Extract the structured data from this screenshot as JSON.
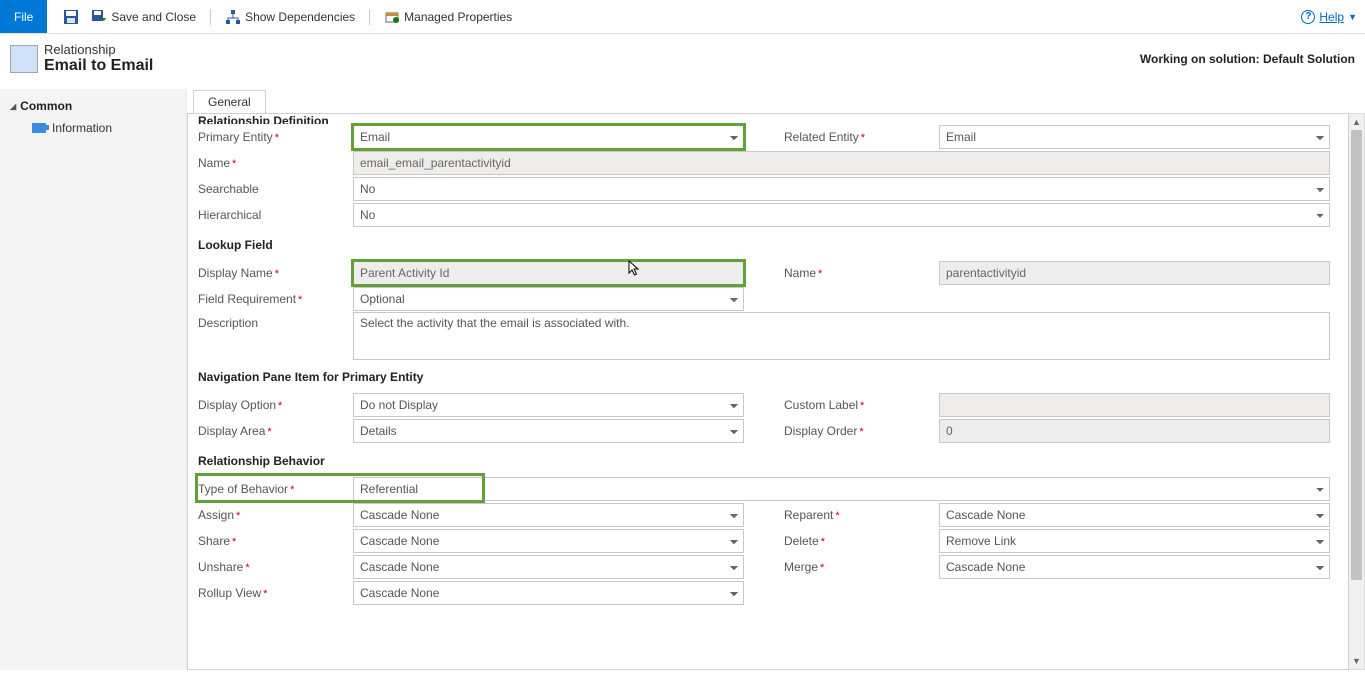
{
  "toolbar": {
    "file": "File",
    "save": "",
    "save_close": "Save and Close",
    "show_deps": "Show Dependencies",
    "managed_props": "Managed Properties",
    "help": "Help"
  },
  "header": {
    "super": "Relationship",
    "title": "Email to Email",
    "solution_text": "Working on solution: Default Solution"
  },
  "nav": {
    "group": "Common",
    "item1": "Information"
  },
  "tabs": {
    "general": "General"
  },
  "sections": {
    "rel_def": "Relationship Definition",
    "lookup": "Lookup Field",
    "navpane": "Navigation Pane Item for Primary Entity",
    "behavior": "Relationship Behavior"
  },
  "labels": {
    "primary_entity": "Primary Entity",
    "related_entity": "Related Entity",
    "name": "Name",
    "searchable": "Searchable",
    "hierarchical": "Hierarchical",
    "display_name": "Display Name",
    "lookup_name": "Name",
    "field_req": "Field Requirement",
    "description": "Description",
    "display_option": "Display Option",
    "custom_label": "Custom Label",
    "display_area": "Display Area",
    "display_order": "Display Order",
    "type_behavior": "Type of Behavior",
    "assign": "Assign",
    "reparent": "Reparent",
    "share": "Share",
    "delete": "Delete",
    "unshare": "Unshare",
    "merge": "Merge",
    "rollup_view": "Rollup View"
  },
  "values": {
    "primary_entity": "Email",
    "related_entity": "Email",
    "name": "email_email_parentactivityid",
    "searchable": "No",
    "hierarchical": "No",
    "display_name": "Parent Activity Id",
    "lookup_name": "parentactivityid",
    "field_req": "Optional",
    "description": "Select the activity that the email is associated with.",
    "display_option": "Do not Display",
    "custom_label": "",
    "display_area": "Details",
    "display_order": "0",
    "type_behavior": "Referential",
    "assign": "Cascade None",
    "reparent": "Cascade None",
    "share": "Cascade None",
    "delete": "Remove Link",
    "unshare": "Cascade None",
    "merge": "Cascade None",
    "rollup_view": "Cascade None"
  }
}
